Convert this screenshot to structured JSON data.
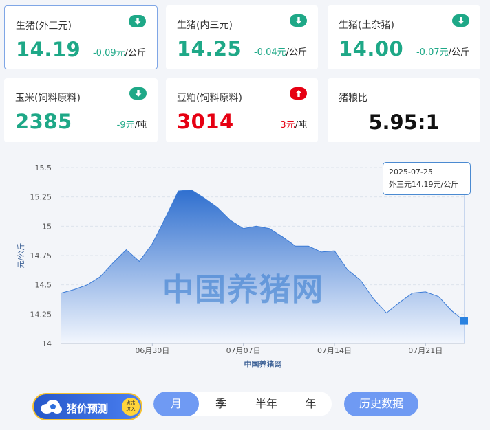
{
  "cards": [
    {
      "title": "生猪(外三元)",
      "value": "14.19",
      "change": "-0.09元",
      "unit": "/公斤",
      "trend": "down"
    },
    {
      "title": "生猪(内三元)",
      "value": "14.25",
      "change": "-0.04元",
      "unit": "/公斤",
      "trend": "down"
    },
    {
      "title": "生猪(土杂猪)",
      "value": "14.00",
      "change": "-0.07元",
      "unit": "/公斤",
      "trend": "down"
    },
    {
      "title": "玉米(饲料原料)",
      "value": "2385",
      "change": "-9元",
      "unit": "/吨",
      "trend": "down"
    },
    {
      "title": "豆粕(饲料原料)",
      "value": "3014",
      "change": "3元",
      "unit": "/吨",
      "trend": "up"
    },
    {
      "title": "猪粮比",
      "value": "5.95:1"
    }
  ],
  "colors": {
    "down": "#1ea887",
    "up": "#e60012",
    "accent": "#6f9af3"
  },
  "icons": {
    "down": "arrow-down-icon",
    "up": "arrow-up-icon"
  },
  "tooltip": {
    "date": "2025-07-25",
    "text": "外三元14.19元/公斤"
  },
  "watermark": "中国养猪网",
  "promo": {
    "label": "猪价预测",
    "dot": "点击\n进入"
  },
  "period_tabs": [
    "月",
    "季",
    "半年",
    "年"
  ],
  "selected_tab": "月",
  "history_button": "历史数据",
  "chart_data": {
    "type": "area",
    "ylabel": "元/公斤",
    "xlabel": "中国养猪网",
    "ylim": [
      14,
      15.5
    ],
    "yticks": [
      "14",
      "14.25",
      "14.5",
      "14.75",
      "15",
      "15.25",
      "15.5"
    ],
    "xticks": [
      {
        "label": "06月30日",
        "index": 7
      },
      {
        "label": "07月07日",
        "index": 14
      },
      {
        "label": "07月14日",
        "index": 21
      },
      {
        "label": "07月21日",
        "index": 28
      }
    ],
    "grid": true,
    "series": [
      {
        "values": [
          14.43,
          14.46,
          14.5,
          14.57,
          14.69,
          14.8,
          14.7,
          14.85,
          15.07,
          15.3,
          15.31,
          15.24,
          15.16,
          15.05,
          14.98,
          15.0,
          14.98,
          14.91,
          14.83,
          14.83,
          14.78,
          14.79,
          14.63,
          14.54,
          14.38,
          14.26,
          14.35,
          14.43,
          14.44,
          14.4,
          14.28,
          14.19
        ]
      }
    ]
  }
}
